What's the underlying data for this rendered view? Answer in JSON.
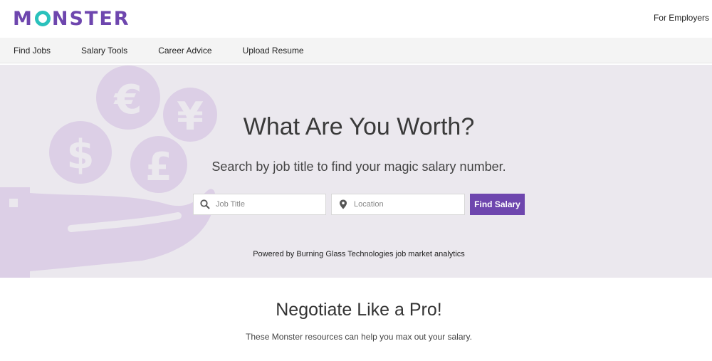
{
  "header": {
    "logo_text": "MONSTER",
    "employers_link": "For Employers"
  },
  "nav": {
    "items": [
      {
        "label": "Find Jobs"
      },
      {
        "label": "Salary Tools"
      },
      {
        "label": "Career Advice"
      },
      {
        "label": "Upload Resume"
      }
    ]
  },
  "hero": {
    "title": "What Are You Worth?",
    "subtitle": "Search by job title to find your magic salary number.",
    "job_title_placeholder": "Job Title",
    "location_placeholder": "Location",
    "find_button": "Find Salary",
    "powered_by": "Powered by Burning Glass Technologies job market analytics",
    "art_icons": [
      "euro-icon",
      "yen-icon",
      "dollar-icon",
      "pound-icon",
      "hand-icon"
    ]
  },
  "resources": {
    "title": "Negotiate Like a Pro!",
    "subtitle": "These Monster resources can help you max out your salary."
  },
  "colors": {
    "brand_purple": "#6e46ae",
    "brand_teal": "#2ac1bc",
    "hero_bg": "#ebe8ee",
    "art_lilac": "#dccfe6",
    "nav_bg": "#f4f4f4"
  }
}
